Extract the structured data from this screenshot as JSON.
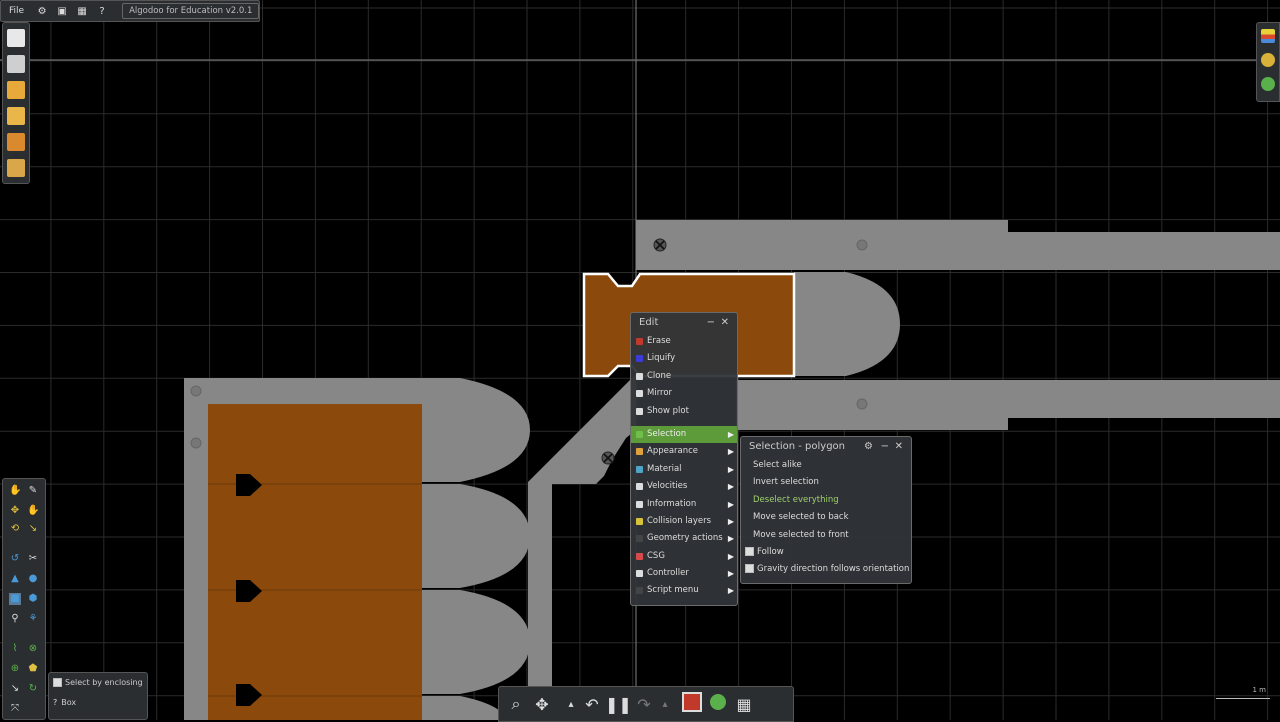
{
  "app": {
    "menu_label": "File",
    "title": "Algodoo for Education v2.0.1"
  },
  "edit_menu": {
    "title": "Edit",
    "items": [
      {
        "label": "Erase",
        "icon": "erase-icon",
        "color": "#c0392b"
      },
      {
        "label": "Liquify",
        "icon": "liquify-icon",
        "color": "#3b3bd9"
      },
      {
        "label": "Clone",
        "icon": "clone-icon",
        "color": "#dddddd"
      },
      {
        "label": "Mirror",
        "icon": "mirror-icon",
        "color": "#dddddd"
      },
      {
        "label": "Show plot",
        "icon": "plot-icon",
        "color": "#dddddd"
      }
    ],
    "submenus": [
      {
        "label": "Selection",
        "icon": "selection-icon",
        "color": "#6fbf4a",
        "active": true
      },
      {
        "label": "Appearance",
        "icon": "appearance-icon",
        "color": "#e0a13a"
      },
      {
        "label": "Material",
        "icon": "material-icon",
        "color": "#4ea5c8"
      },
      {
        "label": "Velocities",
        "icon": "velocities-icon",
        "color": "#dddddd"
      },
      {
        "label": "Information",
        "icon": "information-icon",
        "color": "#dddddd"
      },
      {
        "label": "Collision layers",
        "icon": "collision-layers-icon",
        "color": "#d8c23a"
      },
      {
        "label": "Geometry actions",
        "icon": "geometry-icon",
        "color": "#444444"
      },
      {
        "label": "CSG",
        "icon": "csg-icon",
        "color": "#d84a4a"
      },
      {
        "label": "Controller",
        "icon": "controller-icon",
        "color": "#dddddd"
      },
      {
        "label": "Script menu",
        "icon": "script-icon",
        "color": "#444444"
      }
    ]
  },
  "selection_menu": {
    "title": "Selection - polygon",
    "items": [
      {
        "label": "Select alike"
      },
      {
        "label": "Invert selection"
      },
      {
        "label": "Deselect everything",
        "highlight": true
      },
      {
        "label": "Move selected to back"
      },
      {
        "label": "Move selected to front"
      }
    ],
    "checks": [
      {
        "label": "Follow",
        "checked": false
      },
      {
        "label": "Gravity direction follows orientation",
        "checked": false
      }
    ]
  },
  "select_options": {
    "checkbox_label": "Select by enclosing",
    "mode_label": "Box"
  },
  "scale_label": "1 m",
  "colors": {
    "accent": "#5d9a3a",
    "orange_body": "#8b4a0c",
    "gray_body": "#8a8a8a"
  }
}
